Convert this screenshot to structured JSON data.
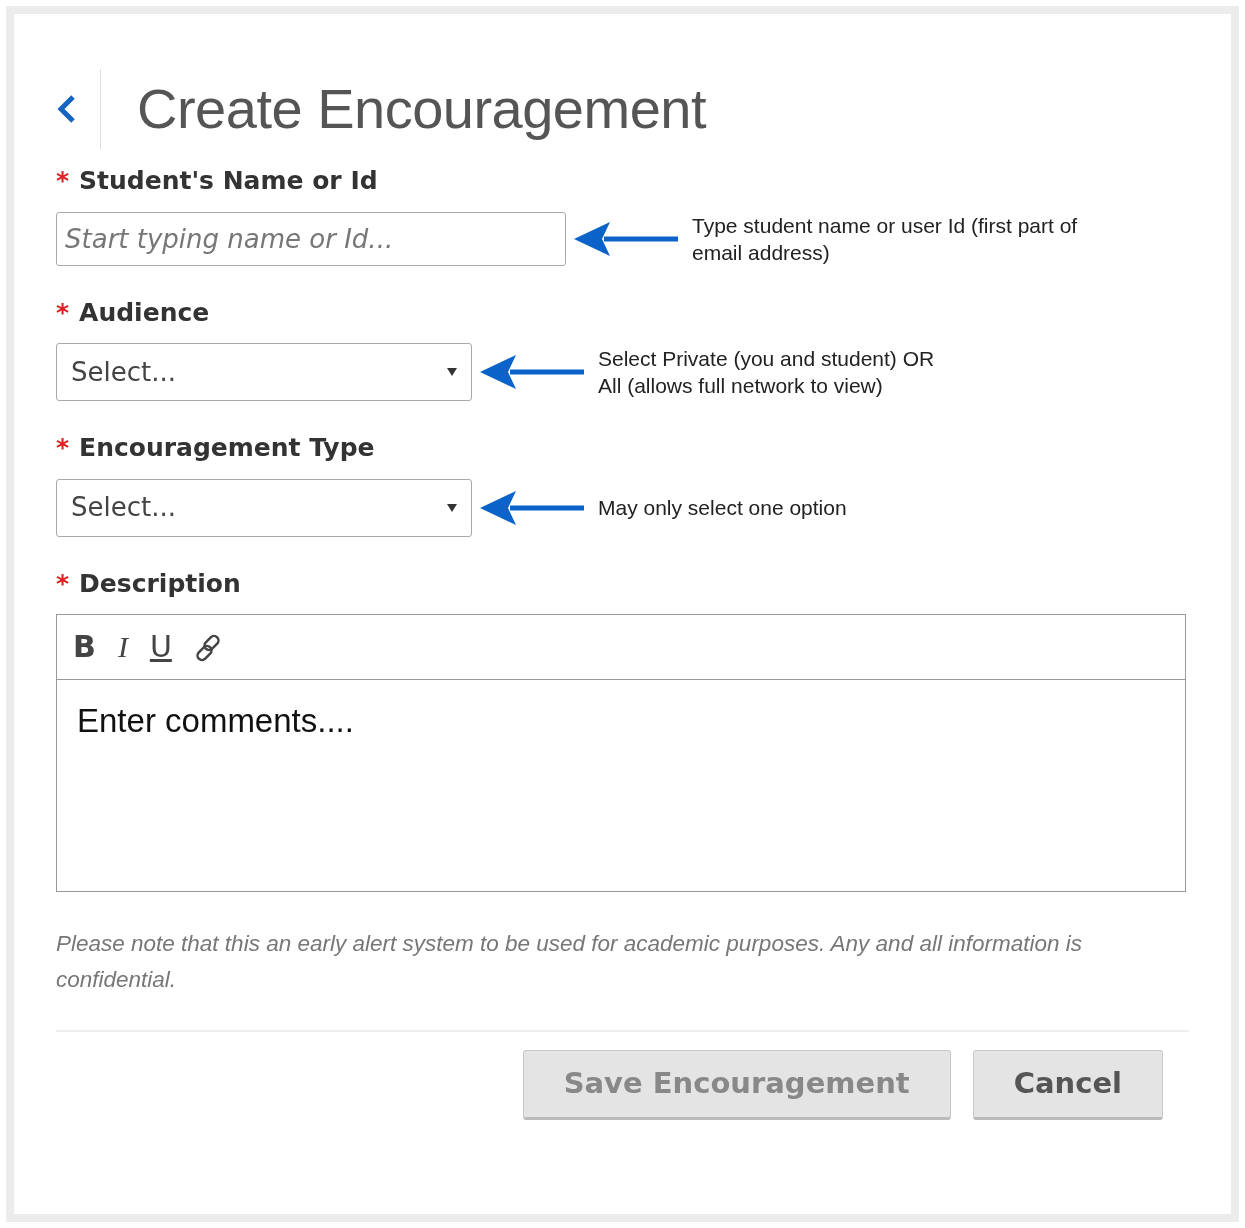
{
  "header": {
    "title": "Create Encouragement"
  },
  "fields": [
    {
      "kind": "text",
      "label": "Student's Name or Id",
      "required_mark": "*",
      "placeholder": "Start typing name or Id...",
      "hint_lines": [
        "Type student name or user Id (first part of",
        "email address)"
      ]
    },
    {
      "kind": "select",
      "label": "Audience",
      "required_mark": "*",
      "value": "Select...",
      "hint_lines": [
        "Select Private (you and student) OR",
        "All (allows full network to view)"
      ]
    },
    {
      "kind": "select",
      "label": "Encouragement Type",
      "required_mark": "*",
      "value": "Select...",
      "hint_lines": [
        "May only select one option"
      ]
    }
  ],
  "description": {
    "label": "Description",
    "required_mark": "*",
    "toolbar": [
      {
        "kind": "bold",
        "label": "B"
      },
      {
        "kind": "italic",
        "label": "I"
      },
      {
        "kind": "underline",
        "label": "U"
      },
      {
        "kind": "link"
      }
    ],
    "placeholder": "Enter comments...."
  },
  "note": "Please note that this an early alert system to be used for academic purposes. Any and all information is confidential.",
  "buttons": [
    {
      "label": "Save Encouragement",
      "disabled": true
    },
    {
      "label": "Cancel",
      "disabled": false
    }
  ]
}
